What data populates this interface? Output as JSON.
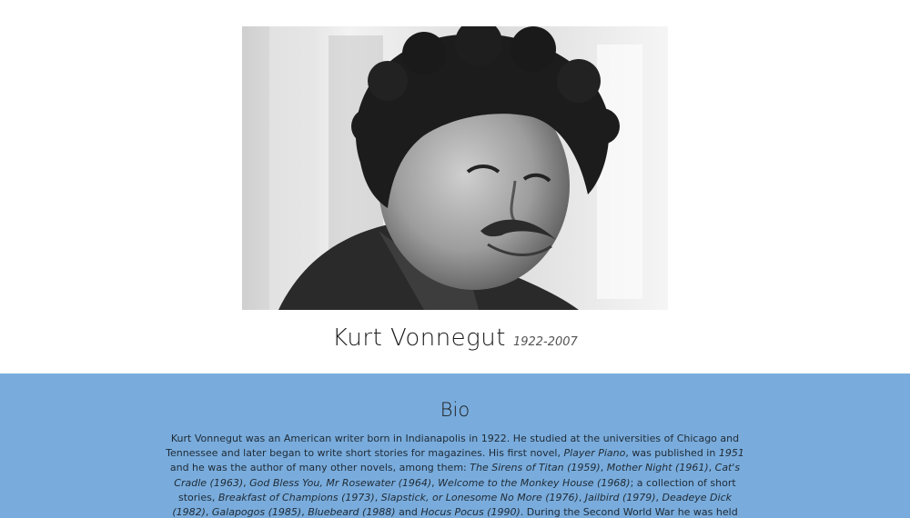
{
  "author": {
    "name": "Kurt Vonnegut",
    "years": "1922-2007"
  },
  "bio": {
    "title": "Bio",
    "paragraph": [
      {
        "t": "Kurt Vonnegut was an American writer born in Indianapolis in 1922. He studied at the universities of Chicago and Tennessee and later began to write short stories for magazines. His first novel, "
      },
      {
        "t": "Player Piano",
        "i": true
      },
      {
        "t": ", was published in "
      },
      {
        "t": "1951",
        "i": true
      },
      {
        "t": " and he was the author of many other novels, among them: "
      },
      {
        "t": "The Sirens of Titan (1959)",
        "i": true
      },
      {
        "t": ", "
      },
      {
        "t": "Mother Night (1961)",
        "i": true
      },
      {
        "t": ", "
      },
      {
        "t": "Cat's Cradle (1963)",
        "i": true
      },
      {
        "t": ", "
      },
      {
        "t": "God Bless You, Mr Rosewater (1964)",
        "i": true
      },
      {
        "t": ", "
      },
      {
        "t": "Welcome to the Monkey House (1968)",
        "i": true
      },
      {
        "t": "; a collection of short stories, "
      },
      {
        "t": "Breakfast of Champions (1973)",
        "i": true
      },
      {
        "t": ", "
      },
      {
        "t": "Slapstick, or Lonesome No More (1976)",
        "i": true
      },
      {
        "t": ", "
      },
      {
        "t": "Jailbird (1979)",
        "i": true
      },
      {
        "t": ", "
      },
      {
        "t": "Deadeye Dick (1982)",
        "i": true
      },
      {
        "t": ", "
      },
      {
        "t": "Galapogos (1985)",
        "i": true
      },
      {
        "t": ", "
      },
      {
        "t": "Bluebeard (1988)",
        "i": true
      },
      {
        "t": " and "
      },
      {
        "t": "Hocus Pocus (1990)",
        "i": true
      },
      {
        "t": ". During the Second World War he was held prisoner in Germany and was present at the bombing of Dresden, an experience which"
      }
    ]
  },
  "colors": {
    "page_background": "#ffffff",
    "bio_background": "#79acdc"
  }
}
